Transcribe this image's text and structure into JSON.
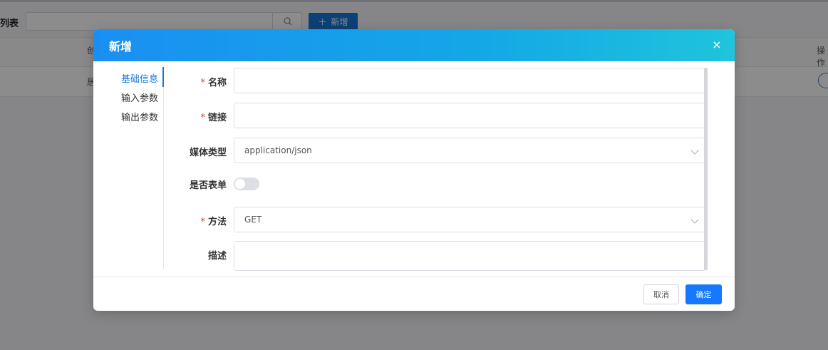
{
  "background": {
    "list_title": "列表",
    "search_placeholder": "",
    "add_button_label": "新增",
    "table_header_col1": "创",
    "table_header_op": "操作",
    "table_row_col1": "居"
  },
  "modal": {
    "title": "新增",
    "close_label": "×",
    "side_nav": [
      {
        "label": "基础信息",
        "active": true
      },
      {
        "label": "输入参数",
        "active": false
      },
      {
        "label": "输出参数",
        "active": false
      }
    ],
    "form": {
      "name_label": "名称",
      "name_value": "",
      "link_label": "链接",
      "link_value": "",
      "media_label": "媒体类型",
      "media_value": "application/json",
      "is_form_label": "是否表单",
      "is_form_on": false,
      "method_label": "方法",
      "method_value": "GET",
      "desc_label": "描述",
      "desc_value": "",
      "required_mark": "*"
    },
    "footer": {
      "cancel_label": "取消",
      "ok_label": "确定"
    }
  },
  "colors": {
    "accent": "#1677d9",
    "header_gradient_start": "#1a8ff2",
    "header_gradient_end": "#1fc4dc",
    "required": "#e23c3c"
  }
}
